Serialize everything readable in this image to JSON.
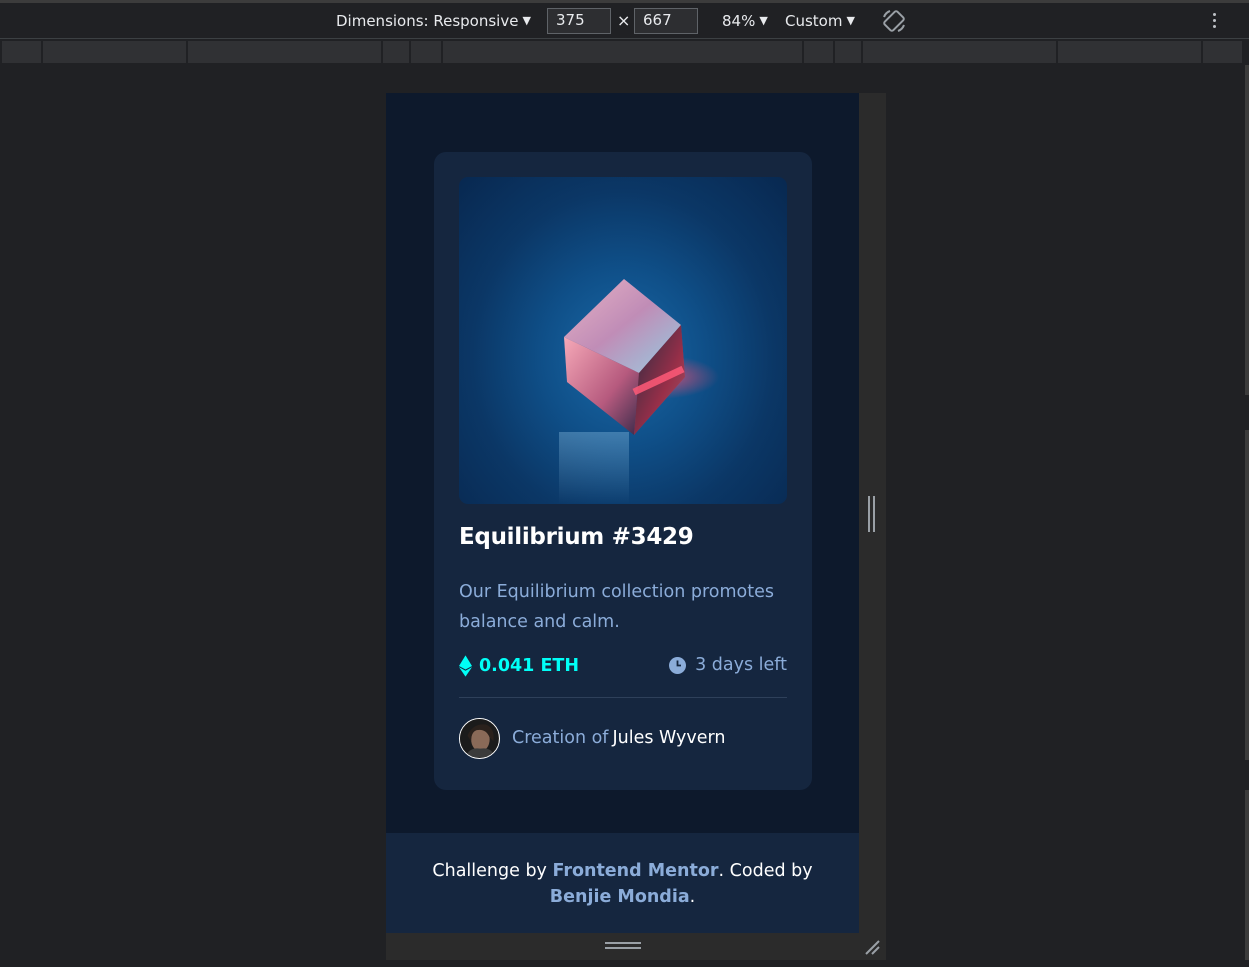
{
  "devtools": {
    "dimensions_label": "Dimensions: Responsive",
    "width_value": "375",
    "times_symbol": "×",
    "height_value": "667",
    "zoom_label": "84%",
    "throttle_label": "Custom",
    "caret": "▼",
    "icons": [
      "rotate-icon",
      "more-options-icon"
    ]
  },
  "card": {
    "title": "Equilibrium #3429",
    "description": "Our Equilibrium collection promotes balance and calm.",
    "price": "0.041 ETH",
    "time_left": "3 days left",
    "creation_prefix": "Creation of",
    "creator_name": "Jules Wyvern",
    "icons": [
      "ethereum-icon",
      "clock-icon",
      "avatar"
    ]
  },
  "footer": {
    "prefix": "Challenge by",
    "link1": "Frontend Mentor",
    "middle": ". Coded by",
    "link2": "Benjie Mondia",
    "suffix": "."
  },
  "colors": {
    "page_bg": "#0d192c",
    "card_bg": "#15263f",
    "cyan": "#00fff7",
    "soft_blue": "#8bacd9",
    "white": "#ffffff"
  }
}
